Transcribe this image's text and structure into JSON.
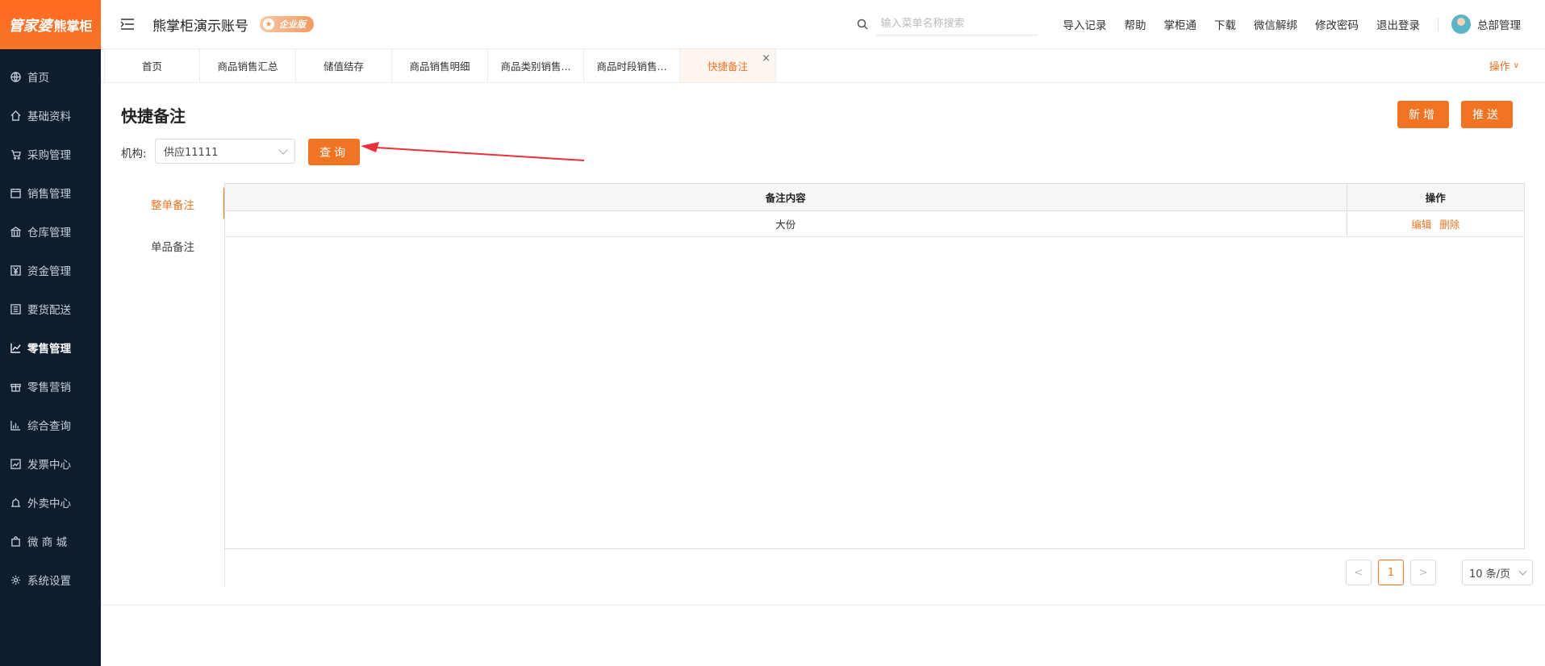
{
  "sidebar": {
    "logo_part1": "管家婆",
    "logo_part2": "熊掌柜",
    "items": [
      {
        "label": "首页",
        "icon": "globe-icon",
        "active": false
      },
      {
        "label": "基础资料",
        "icon": "home-icon",
        "active": false
      },
      {
        "label": "采购管理",
        "icon": "cart-icon",
        "active": false
      },
      {
        "label": "销售管理",
        "icon": "calendar-icon",
        "active": false
      },
      {
        "label": "仓库管理",
        "icon": "bank-icon",
        "active": false
      },
      {
        "label": "资金管理",
        "icon": "yuan-icon",
        "active": false
      },
      {
        "label": "要货配送",
        "icon": "list-icon",
        "active": false
      },
      {
        "label": "零售管理",
        "icon": "chart-icon",
        "active": true
      },
      {
        "label": "零售营销",
        "icon": "gift-icon",
        "active": false
      },
      {
        "label": "综合查询",
        "icon": "bar-chart-icon",
        "active": false
      },
      {
        "label": "发票中心",
        "icon": "trend-icon",
        "active": false
      },
      {
        "label": "外卖中心",
        "icon": "alarm-icon",
        "active": false
      },
      {
        "label": "微 商 城",
        "icon": "bag-icon",
        "active": false
      },
      {
        "label": "系统设置",
        "icon": "gear-icon",
        "active": false
      }
    ]
  },
  "header": {
    "account_title": "熊掌柜演示账号",
    "badge": "企业版",
    "search_placeholder": "输入菜单名称搜索",
    "links": [
      "导入记录",
      "帮助",
      "掌柜通",
      "下载",
      "微信解绑",
      "修改密码",
      "退出登录"
    ],
    "user_name": "总部管理"
  },
  "tabs": {
    "items": [
      {
        "label": "首页",
        "active": false
      },
      {
        "label": "商品销售汇总",
        "active": false
      },
      {
        "label": "储值结存",
        "active": false
      },
      {
        "label": "商品销售明细",
        "active": false
      },
      {
        "label": "商品类别销售...",
        "active": false
      },
      {
        "label": "商品时段销售...",
        "active": false
      },
      {
        "label": "快捷备注",
        "active": true
      }
    ],
    "close_symbol": "×",
    "ops_label": "操作"
  },
  "main": {
    "page_title": "快捷备注",
    "add_button": "新增",
    "push_button": "推送",
    "org_label": "机构:",
    "org_value": "供应11111",
    "query_button": "查询",
    "side_tabs": [
      {
        "label": "整单备注",
        "active": true
      },
      {
        "label": "单品备注",
        "active": false
      }
    ],
    "table": {
      "columns": [
        "备注内容",
        "操作"
      ],
      "rows": [
        {
          "content": "大份",
          "actions": [
            "编辑",
            "删除"
          ]
        }
      ]
    },
    "pager": {
      "prev": "<",
      "current": "1",
      "next": ">",
      "page_size": "10 条/页"
    }
  },
  "colors": {
    "accent": "#f07423",
    "sidebar_bg": "#0f1c2d",
    "arrow": "#e8313a"
  }
}
